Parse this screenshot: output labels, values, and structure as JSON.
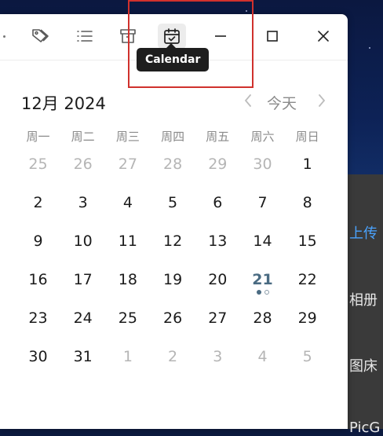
{
  "toolbar": {
    "tooltip": "Calendar",
    "icons": [
      "tag-icon",
      "list-icon",
      "archive-icon",
      "calendar-check-icon",
      "minimize-icon",
      "maximize-icon",
      "close-icon"
    ]
  },
  "calendar": {
    "month_label": "12月 2024",
    "today_label": "今天",
    "weekdays": [
      "周一",
      "周二",
      "周三",
      "周四",
      "周五",
      "周六",
      "周日"
    ],
    "weeks": [
      [
        {
          "d": "25",
          "other": true
        },
        {
          "d": "26",
          "other": true
        },
        {
          "d": "27",
          "other": true
        },
        {
          "d": "28",
          "other": true
        },
        {
          "d": "29",
          "other": true
        },
        {
          "d": "30",
          "other": true
        },
        {
          "d": "1",
          "other": false
        }
      ],
      [
        {
          "d": "2",
          "other": false
        },
        {
          "d": "3",
          "other": false
        },
        {
          "d": "4",
          "other": false
        },
        {
          "d": "5",
          "other": false
        },
        {
          "d": "6",
          "other": false
        },
        {
          "d": "7",
          "other": false
        },
        {
          "d": "8",
          "other": false
        }
      ],
      [
        {
          "d": "9",
          "other": false
        },
        {
          "d": "10",
          "other": false
        },
        {
          "d": "11",
          "other": false
        },
        {
          "d": "12",
          "other": false
        },
        {
          "d": "13",
          "other": false
        },
        {
          "d": "14",
          "other": false
        },
        {
          "d": "15",
          "other": false
        }
      ],
      [
        {
          "d": "16",
          "other": false
        },
        {
          "d": "17",
          "other": false
        },
        {
          "d": "18",
          "other": false
        },
        {
          "d": "19",
          "other": false
        },
        {
          "d": "20",
          "other": false
        },
        {
          "d": "21",
          "other": false,
          "today": true
        },
        {
          "d": "22",
          "other": false
        }
      ],
      [
        {
          "d": "23",
          "other": false
        },
        {
          "d": "24",
          "other": false
        },
        {
          "d": "25",
          "other": false
        },
        {
          "d": "26",
          "other": false
        },
        {
          "d": "27",
          "other": false
        },
        {
          "d": "28",
          "other": false
        },
        {
          "d": "29",
          "other": false
        }
      ],
      [
        {
          "d": "30",
          "other": false
        },
        {
          "d": "31",
          "other": false
        },
        {
          "d": "1",
          "other": true
        },
        {
          "d": "2",
          "other": true
        },
        {
          "d": "3",
          "other": true
        },
        {
          "d": "4",
          "other": true
        },
        {
          "d": "5",
          "other": true
        }
      ]
    ]
  },
  "background_window": {
    "items": [
      "上传",
      "相册",
      "图床",
      "PicG"
    ]
  },
  "colors": {
    "highlight": "#d0312d",
    "today": "#4a6b82",
    "link": "#4aa3ff"
  }
}
